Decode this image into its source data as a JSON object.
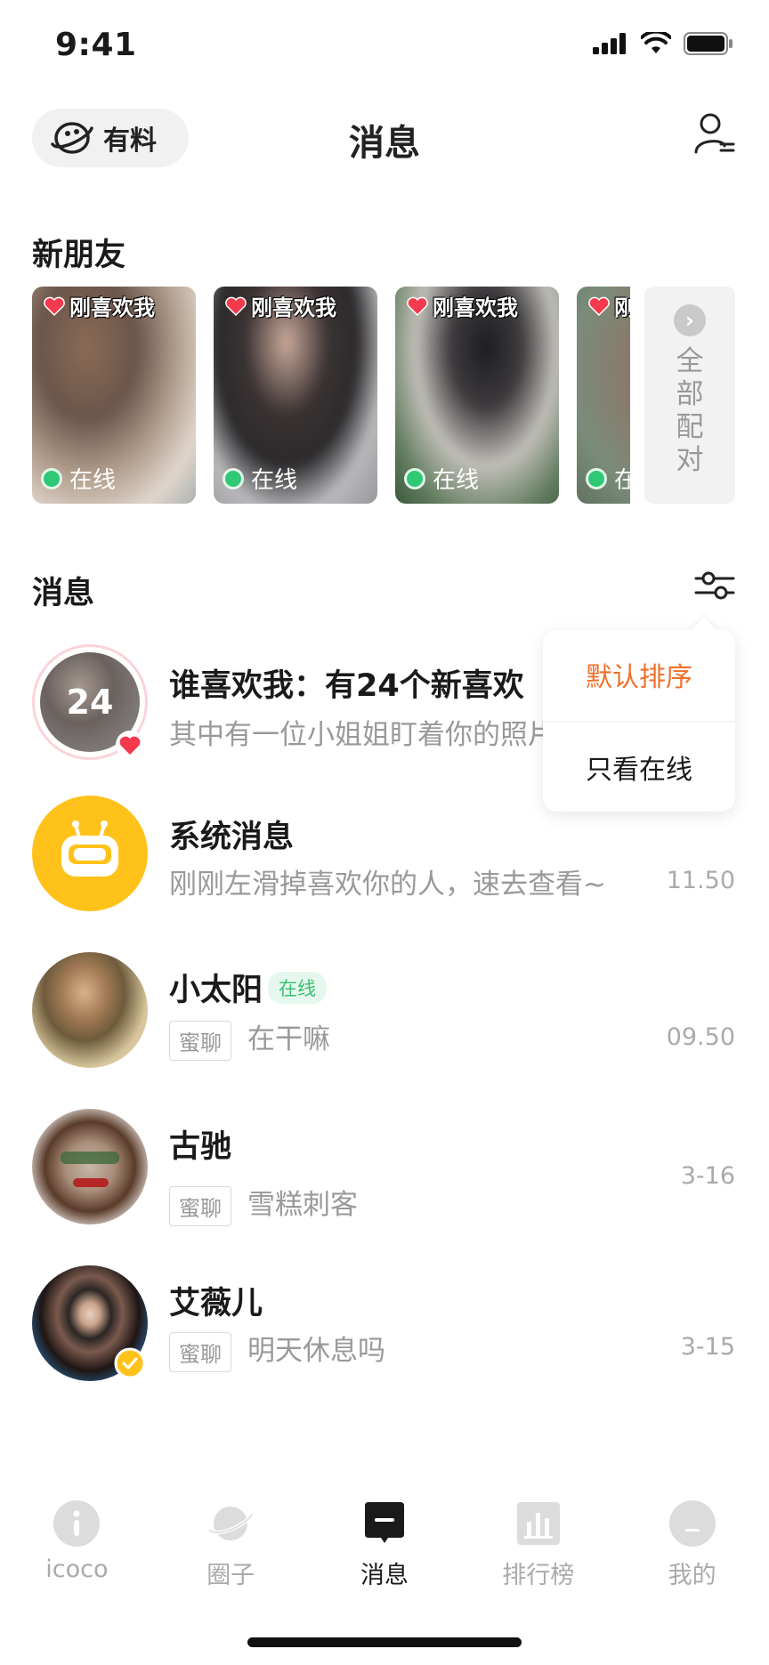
{
  "status_bar": {
    "time": "9:41"
  },
  "header": {
    "brand_label": "有料",
    "title": "消息"
  },
  "new_friends": {
    "title": "新朋友",
    "cards": [
      {
        "tag": "刚喜欢我",
        "status": "在线"
      },
      {
        "tag": "刚喜欢我",
        "status": "在线"
      },
      {
        "tag": "刚喜欢我",
        "status": "在线"
      },
      {
        "tag": "刚喜欢我",
        "status": "在线"
      }
    ],
    "all_match_label": "全部配对"
  },
  "messages": {
    "title": "消息",
    "items": [
      {
        "name": "谁喜欢我：有24个新喜欢",
        "preview": "其中有一位小姐姐盯着你的照片",
        "avatar_count": "24",
        "time": ""
      },
      {
        "name": "系统消息",
        "preview": "刚刚左滑掉喜欢你的人，速去查看~",
        "time": "11.50"
      },
      {
        "name": "小太阳",
        "online": "在线",
        "tag": "蜜聊",
        "preview": "在干嘛",
        "time": "09.50"
      },
      {
        "name": "古驰",
        "tag": "蜜聊",
        "preview": "雪糕刺客",
        "time": "3-16"
      },
      {
        "name": "艾薇儿",
        "tag": "蜜聊",
        "preview": "明天休息吗",
        "time": "3-15"
      }
    ]
  },
  "sort_menu": {
    "options": [
      "默认排序",
      "只看在线"
    ],
    "selected": "默认排序",
    "accent": "#f0702a"
  },
  "tab_bar": {
    "tabs": [
      {
        "label": "icoco",
        "icon": "info-icon"
      },
      {
        "label": "圈子",
        "icon": "planet-icon"
      },
      {
        "label": "消息",
        "icon": "message-icon"
      },
      {
        "label": "排行榜",
        "icon": "chart-icon"
      },
      {
        "label": "我的",
        "icon": "profile-icon"
      }
    ],
    "active": "消息"
  },
  "colors": {
    "online_green": "#2fc874",
    "system_yellow": "#ffc21a",
    "heart_red": "#f43a4c"
  }
}
